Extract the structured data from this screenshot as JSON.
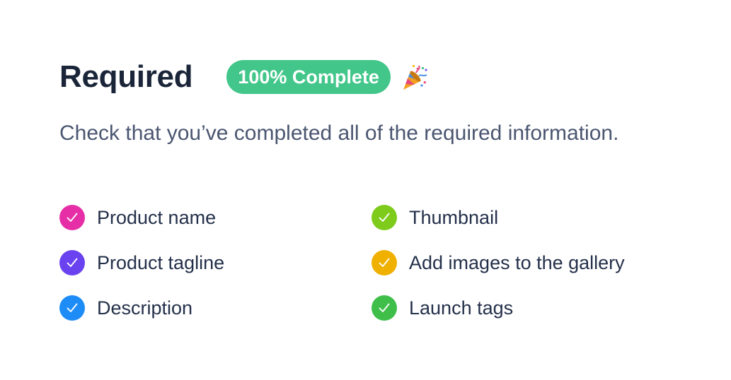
{
  "header": {
    "title": "Required",
    "badge_text": "100% Complete",
    "badge_color": "#42c68a",
    "celebration_icon": "party-popper-icon"
  },
  "subtitle": "Check that you’ve completed all of the required information.",
  "checklist": {
    "items": [
      {
        "label": "Product name",
        "checked": true,
        "color": "#e62fa6",
        "icon": "checkmark-icon"
      },
      {
        "label": "Thumbnail",
        "checked": true,
        "color": "#7ecb1c",
        "icon": "checkmark-icon"
      },
      {
        "label": "Product tagline",
        "checked": true,
        "color": "#6a42f0",
        "icon": "checkmark-icon"
      },
      {
        "label": "Add images to the gallery",
        "checked": true,
        "color": "#f0b000",
        "icon": "checkmark-icon"
      },
      {
        "label": "Description",
        "checked": true,
        "color": "#1e8cf7",
        "icon": "checkmark-icon"
      },
      {
        "label": "Launch tags",
        "checked": true,
        "color": "#3fbf4a",
        "icon": "checkmark-icon"
      }
    ]
  }
}
